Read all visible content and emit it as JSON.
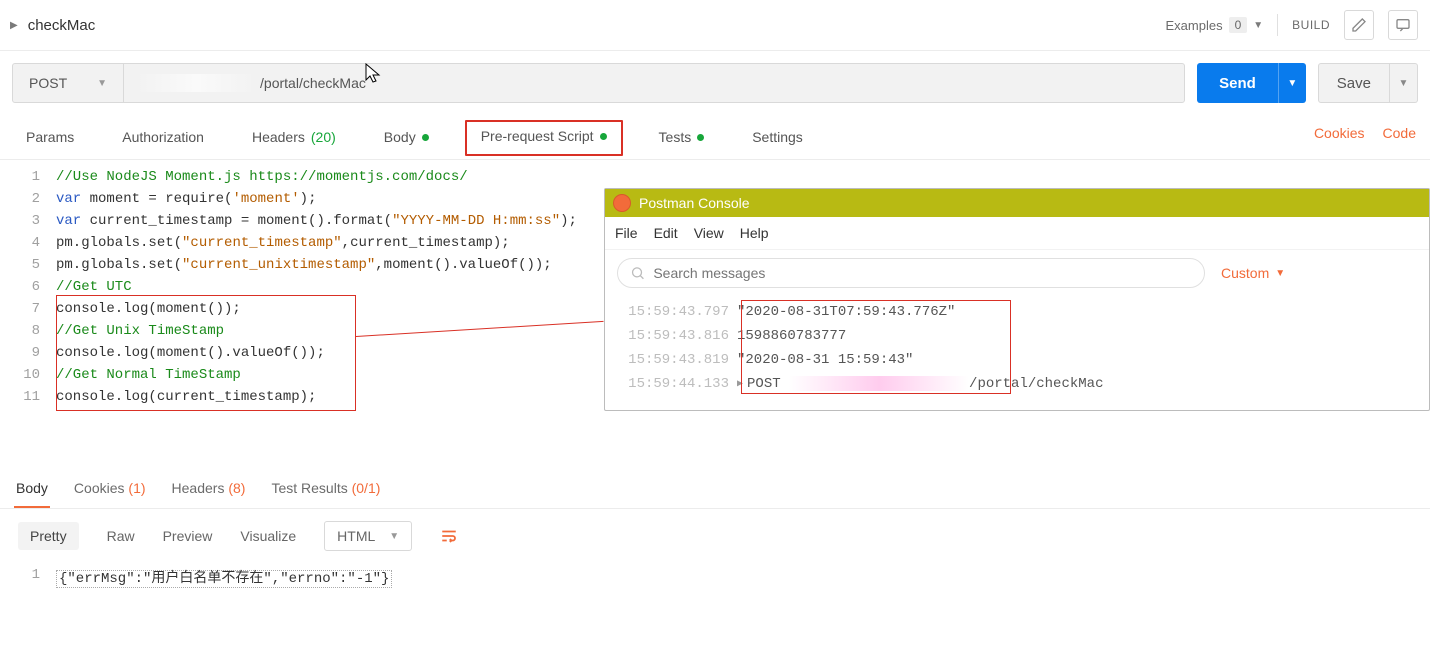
{
  "request": {
    "name": "checkMac",
    "method": "POST",
    "url_visible": "/portal/checkMac",
    "examples_label": "Examples",
    "examples_count": "0",
    "build_label": "BUILD"
  },
  "tabs": {
    "params": "Params",
    "authorization": "Authorization",
    "headers": "Headers",
    "headers_count": "(20)",
    "body": "Body",
    "prerequest": "Pre-request Script",
    "tests": "Tests",
    "settings": "Settings",
    "cookies_link": "Cookies",
    "code_link": "Code"
  },
  "code": {
    "l1": "//Use NodeJS Moment.js https://momentjs.com/docs/",
    "l2a": "var",
    "l2b": " moment = require(",
    "l2c": "'moment'",
    "l2d": ");",
    "l3a": "var",
    "l3b": " current_timestamp = moment().format(",
    "l3c": "\"YYYY-MM-DD H:mm:ss\"",
    "l3d": ");",
    "l4a": "pm.globals.set(",
    "l4b": "\"current_timestamp\"",
    "l4c": ",current_timestamp);",
    "l5a": "pm.globals.set(",
    "l5b": "\"current_unixtimestamp\"",
    "l5c": ",moment().valueOf());",
    "l6": "//Get UTC",
    "l7": "console.log(moment());",
    "l8": "//Get Unix TimeStamp",
    "l9": "console.log(moment().valueOf());",
    "l10": "//Get Normal TimeStamp",
    "l11": "console.log(current_timestamp);"
  },
  "response": {
    "tabs": {
      "body": "Body",
      "cookies": "Cookies",
      "cookies_count": "(1)",
      "headers": "Headers",
      "headers_count": "(8)",
      "testresults": "Test Results",
      "testresults_count": "(0/1)"
    },
    "view": {
      "pretty": "Pretty",
      "raw": "Raw",
      "preview": "Preview",
      "visualize": "Visualize",
      "format": "HTML"
    },
    "body_text": "{\"errMsg\":\"用户白名单不存在\",\"errno\":\"-1\"}"
  },
  "console": {
    "title": "Postman Console",
    "menu": {
      "file": "File",
      "edit": "Edit",
      "view": "View",
      "help": "Help"
    },
    "search_placeholder": "Search messages",
    "custom": "Custom",
    "rows": [
      {
        "ts": "15:59:43.797",
        "val": "\"2020-08-31T07:59:43.776Z\""
      },
      {
        "ts": "15:59:43.816",
        "val": "1598860783777"
      },
      {
        "ts": "15:59:43.819",
        "val": "\"2020-08-31 15:59:43\""
      }
    ],
    "post_row": {
      "ts": "15:59:44.133",
      "method": "POST",
      "suffix": "/portal/checkMac"
    }
  },
  "buttons": {
    "send": "Send",
    "save": "Save"
  }
}
